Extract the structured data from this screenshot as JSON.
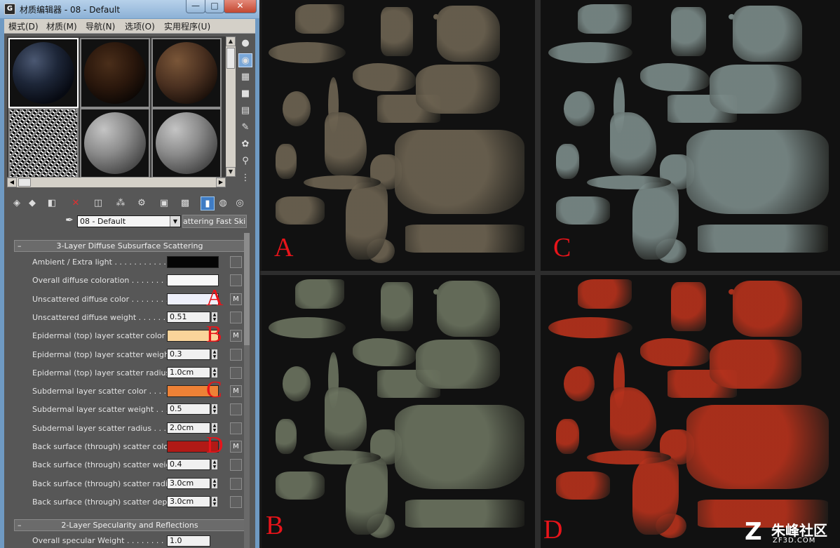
{
  "window": {
    "title": "材质编辑器 - 08 - Default",
    "min_glyph": "—",
    "max_glyph": "□",
    "close_glyph": "✕"
  },
  "menu": [
    "模式(D)",
    "材质(M)",
    "导航(N)",
    "选项(O)",
    "实用程序(U)"
  ],
  "material": {
    "name": "08 - Default",
    "type_button": "attering Fast Skin"
  },
  "rollout1": {
    "title": "3-Layer Diffuse Subsurface Scattering",
    "collapse_glyph": "–",
    "params": [
      {
        "label": "Ambient / Extra light . . . . . . . . . . . . .",
        "kind": "color",
        "color": "#050505"
      },
      {
        "label": "Overall diffuse coloration . . . . . . . . . .",
        "kind": "color",
        "color": "#f8f8f8"
      },
      {
        "label": "Unscattered diffuse color . . . . . . . . . .",
        "kind": "color",
        "color": "#eef0fb",
        "map": "M",
        "annotation": "A"
      },
      {
        "label": "Unscattered diffuse weight . . . . . . . .",
        "kind": "spinner",
        "value": "0.51"
      },
      {
        "label": "Epidermal (top) layer scatter color . . . .",
        "kind": "color",
        "color": "#fad49a",
        "map": "M",
        "annotation": "B"
      },
      {
        "label": "Epidermal (top) layer scatter weight . .",
        "kind": "spinner",
        "value": "0.3"
      },
      {
        "label": "Epidermal (top) layer scatter radius . . .",
        "kind": "spinner",
        "value": "1.0cm"
      },
      {
        "label": "Subdermal layer scatter color . . . . . . .",
        "kind": "color",
        "color": "#ee8136",
        "map": "M",
        "annotation": "C"
      },
      {
        "label": "Subdermal layer scatter weight . . . . . .",
        "kind": "spinner",
        "value": "0.5"
      },
      {
        "label": "Subdermal layer scatter radius . . . . . .",
        "kind": "spinner",
        "value": "2.0cm"
      },
      {
        "label": "Back surface (through) scatter color . .",
        "kind": "color",
        "color": "#b11a16",
        "map": "M",
        "annotation": "D"
      },
      {
        "label": "Back surface (through) scatter weight .",
        "kind": "spinner",
        "value": "0.4"
      },
      {
        "label": "Back surface (through) scatter radius .",
        "kind": "spinner",
        "value": "3.0cm"
      },
      {
        "label": "Back surface (through) scatter depth .",
        "kind": "spinner",
        "value": "3.0cm"
      }
    ]
  },
  "rollout2": {
    "title": "2-Layer Specularity and Reflections",
    "collapse_glyph": "–",
    "first_param_label": "Overall specular Weight . . . . . . . . . .",
    "first_param_value": "1.0"
  },
  "textures": [
    {
      "label": "A",
      "tint": "#6e6452"
    },
    {
      "label": "C",
      "tint": "#7c8c8a"
    },
    {
      "label": "B",
      "tint": "#6c7460"
    },
    {
      "label": "D",
      "tint": "#b8321c"
    }
  ],
  "watermark": {
    "logo": "Z",
    "cn": "朱峰社区",
    "en": "ZF3D.COM"
  }
}
